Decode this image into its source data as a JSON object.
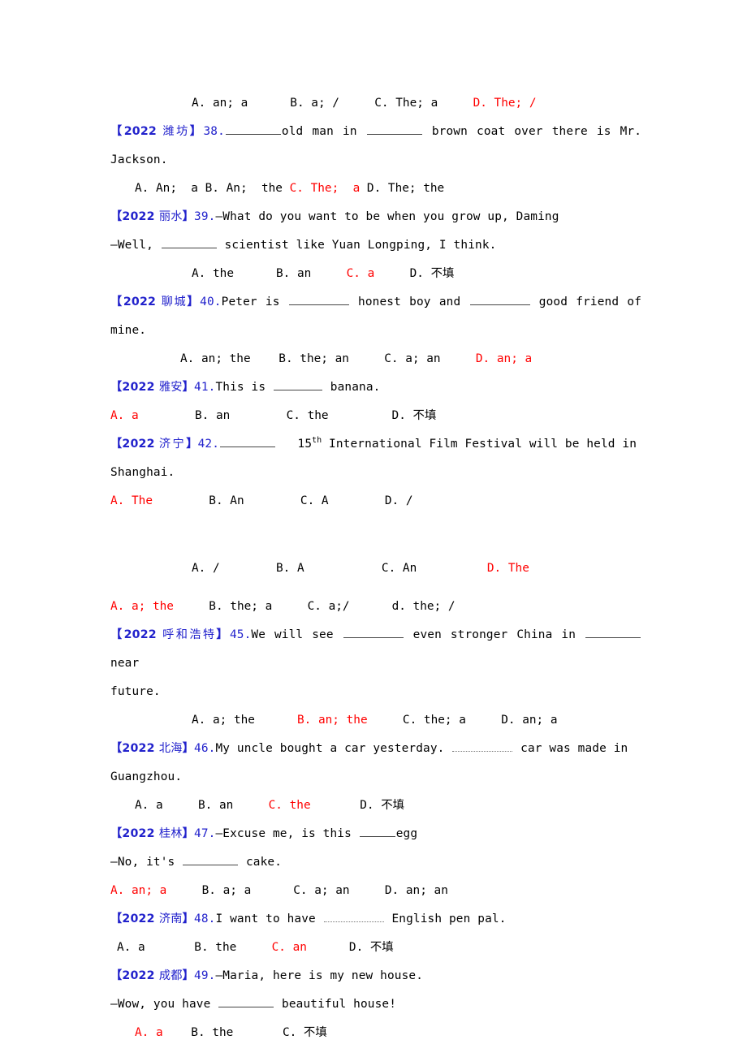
{
  "document": {
    "type": "english-grammar-worksheet",
    "subject": "articles-multiple-choice",
    "colors": {
      "tag_blue": "#2222CC",
      "answer_red": "#FF0000",
      "body_black": "#000000",
      "background": "#FFFFFF"
    }
  },
  "orphan_options_top": {
    "text": "A. an; a      B. a; /     C. The; a     ",
    "answer": "D. The; /"
  },
  "questions": [
    {
      "id": "q38",
      "tag_year": "2022",
      "tag_city": "潍坊",
      "number": "38.",
      "stem_parts": {
        "pre": "",
        "mid": "old man in ",
        "post": " brown coat over there is Mr. Jackson."
      },
      "options_line": {
        "before": "A. An;  a B. An;  the ",
        "answer": "C. The;  a",
        "after": " D. The; the"
      }
    },
    {
      "id": "q39",
      "tag_year": "2022",
      "tag_city": "丽水",
      "number": "39.",
      "stem_line1": "—What do you want to be when you grow up, Daming",
      "stem_line2_pre": "—Well, ",
      "stem_line2_post": " scientist like Yuan Longping, I think.",
      "options_line": {
        "before": "A. the      B. an     ",
        "answer": "C. a",
        "after": "     D. 不填"
      }
    },
    {
      "id": "q40",
      "tag_year": "2022",
      "tag_city": "聊城",
      "number": "40.",
      "stem_pre": "Peter is ",
      "stem_mid": " honest boy and ",
      "stem_post": " good friend of mine.",
      "options_line": {
        "before": "A. an; the    B. the; an     C. a; an     ",
        "answer": "D. an; a",
        "after": ""
      }
    },
    {
      "id": "q41",
      "tag_year": "2022",
      "tag_city": "雅安",
      "number": "41.",
      "stem_pre": "This is ",
      "stem_post": " banana.",
      "options_line": {
        "answer": "A. a",
        "after": "        B. an        C. the         D. 不填"
      }
    },
    {
      "id": "q42",
      "tag_year": "2022",
      "tag_city": "济宁",
      "number": "42.",
      "stem_pre": "",
      "stem_sup_num": "15",
      "stem_sup": "th",
      "stem_post": " International Film Festival will be held in",
      "stem_line2": "Shanghai.",
      "options_line": {
        "answer": "A. The",
        "after": "        B. An        C. A        D. /"
      }
    },
    {
      "id": "q43",
      "note": "stem-not-visible",
      "options_line": {
        "before": "A. /        B. A           C. An          ",
        "answer": "D. The",
        "after": ""
      }
    },
    {
      "id": "q44",
      "note": "stem-not-visible",
      "options_line": {
        "answer": "A. a; the",
        "after": "     B. the; a     C. a;/      d. the; /"
      }
    },
    {
      "id": "q45",
      "tag_year": "2022",
      "tag_city": "呼和浩特",
      "number": "45.",
      "stem_pre": "We will see ",
      "stem_mid": " even stronger China in ",
      "stem_post": " near",
      "stem_line2": "future.",
      "options_line": {
        "before": "A. a; the      ",
        "answer": "B. an; the",
        "after": "     C. the; a     D. an; a"
      }
    },
    {
      "id": "q46",
      "tag_year": "2022",
      "tag_city": "北海",
      "number": "46.",
      "stem_pre": "My uncle bought a car yesterday. ",
      "stem_post": " car was made in",
      "stem_line2": "Guangzhou.",
      "options_line": {
        "before": "A. a     B. an     ",
        "answer": "C. the",
        "after": "       D. 不填"
      }
    },
    {
      "id": "q47",
      "tag_year": "2022",
      "tag_city": "桂林",
      "number": "47.",
      "stem_line1_pre": "—Excuse me, is this ",
      "stem_line1_post": "egg",
      "stem_line2_pre": "—No, it's ",
      "stem_line2_post": " cake.",
      "options_line": {
        "answer": "A. an; a",
        "after": "     B. a; a      C. a; an     D. an; an"
      }
    },
    {
      "id": "q48",
      "tag_year": "2022",
      "tag_city": "济南",
      "number": "48.",
      "stem_pre": "I want to have ",
      "stem_post": " English pen pal.",
      "options_line": {
        "before": "A. a       B. the     ",
        "answer": "C. an",
        "after": "      D. 不填"
      }
    },
    {
      "id": "q49",
      "tag_year": "2022",
      "tag_city": "成都",
      "number": "49.",
      "stem_line1": "—Maria, here is my new house.",
      "stem_line2_pre": "—Wow, you have ",
      "stem_line2_post": " beautiful house!",
      "options_line": {
        "answer": "A. a",
        "after": "    B. the       C. 不填"
      }
    }
  ]
}
